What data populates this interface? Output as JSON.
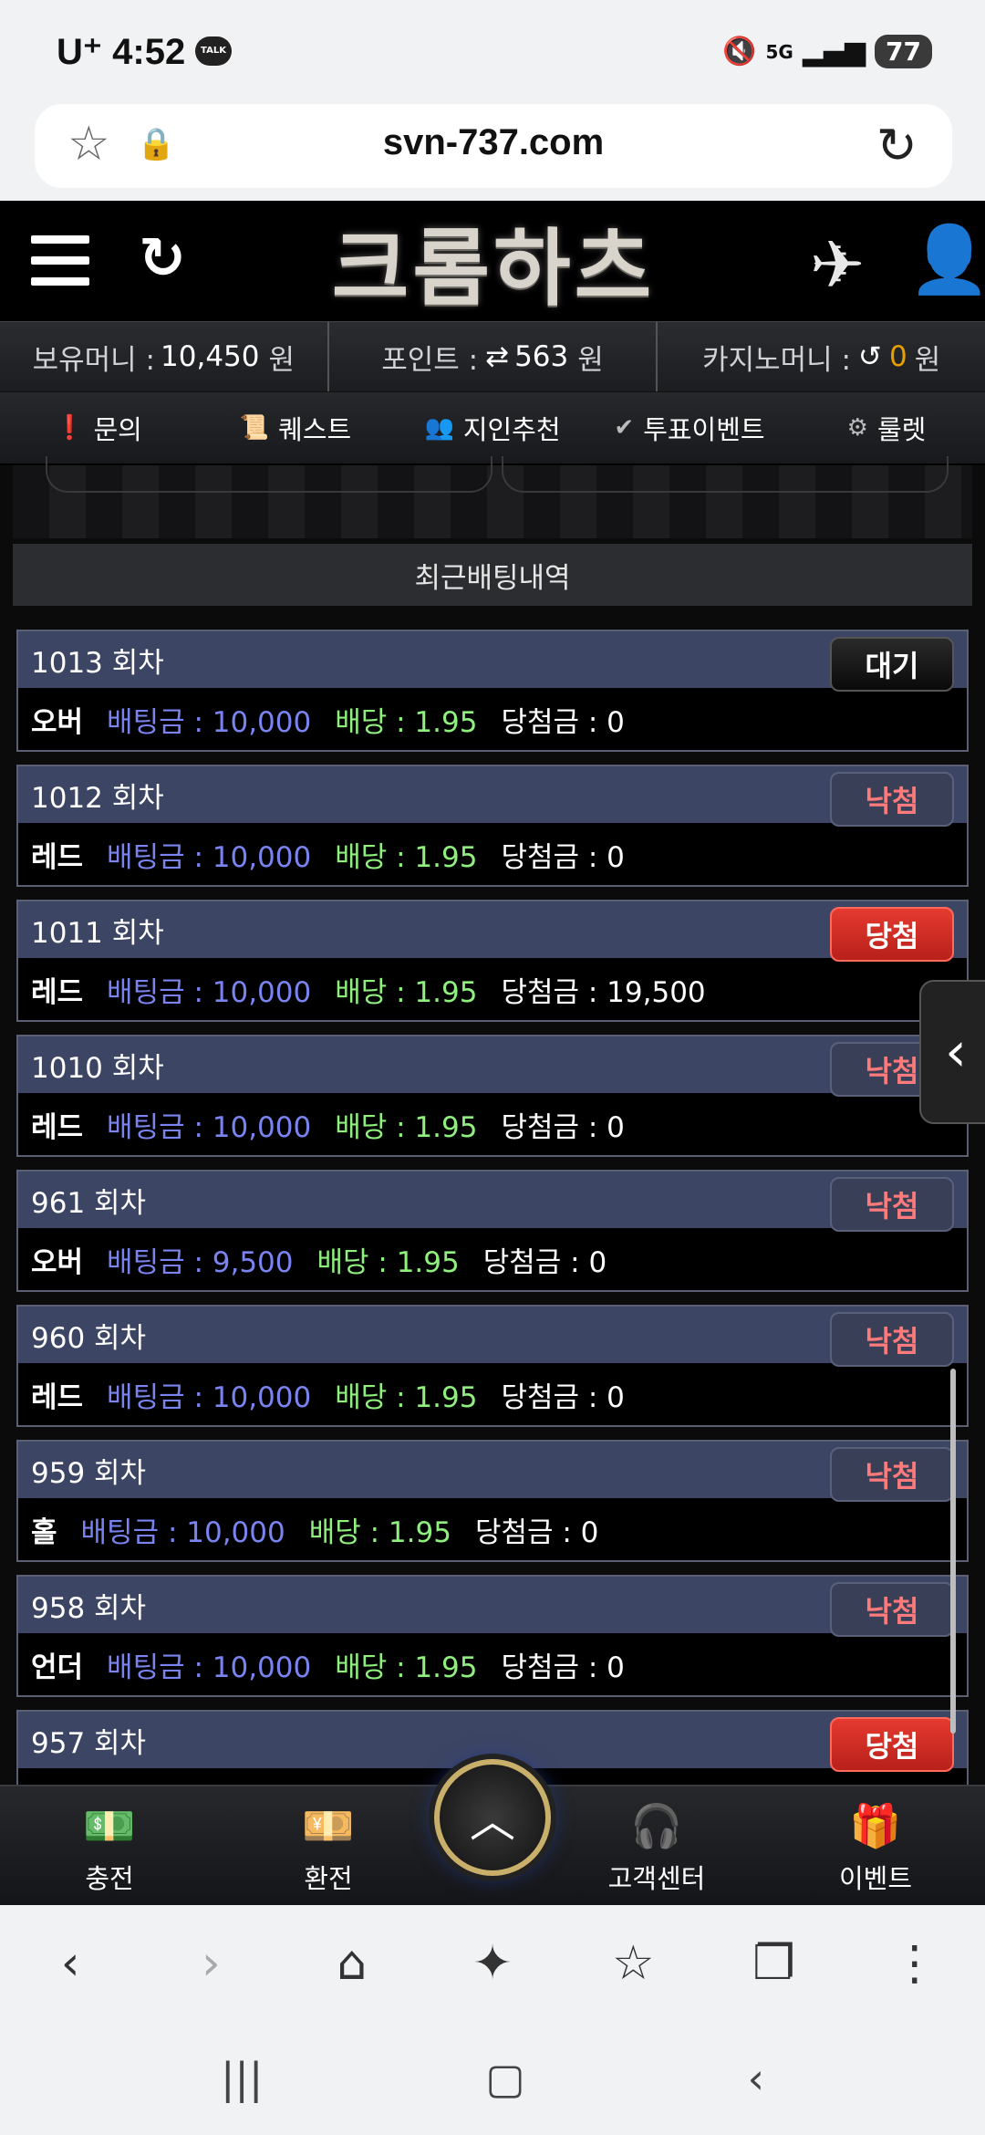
{
  "status_bar": {
    "carrier": "U⁺",
    "time": "4:52",
    "talk_badge": "TALK",
    "network": "5G",
    "battery": "77"
  },
  "browser": {
    "url": "svn-737.com"
  },
  "header": {
    "logo_text": "크롬하츠"
  },
  "money_bar": {
    "holding_label": "보유머니 :",
    "holding_value": "10,450",
    "holding_unit": "원",
    "point_label": "포인트 :",
    "point_value": "563",
    "point_unit": "원",
    "casino_label": "카지노머니 :",
    "casino_value": "0",
    "casino_unit": "원"
  },
  "nav_menu": [
    {
      "label": "문의",
      "icon": "info-icon",
      "glyph": "❗"
    },
    {
      "label": "퀘스트",
      "icon": "quest-icon",
      "glyph": "📜"
    },
    {
      "label": "지인추천",
      "icon": "people-icon",
      "glyph": "👥"
    },
    {
      "label": "투표이벤트",
      "icon": "vote-icon",
      "glyph": "✔"
    },
    {
      "label": "룰렛",
      "icon": "roulette-icon",
      "glyph": "⚙"
    }
  ],
  "section_title": "최근배팅내역",
  "bets": [
    {
      "round": "1013 회차",
      "pick": "오버",
      "amount": "배팅금 : 10,000",
      "odds": "배당 : 1.95",
      "winnings": "당첨금 : 0",
      "status": "대기",
      "status_type": "wait"
    },
    {
      "round": "1012 회차",
      "pick": "레드",
      "amount": "배팅금 : 10,000",
      "odds": "배당 : 1.95",
      "winnings": "당첨금 : 0",
      "status": "낙첨",
      "status_type": "lose"
    },
    {
      "round": "1011 회차",
      "pick": "레드",
      "amount": "배팅금 : 10,000",
      "odds": "배당 : 1.95",
      "winnings": "당첨금 : 19,500",
      "status": "당첨",
      "status_type": "win"
    },
    {
      "round": "1010 회차",
      "pick": "레드",
      "amount": "배팅금 : 10,000",
      "odds": "배당 : 1.95",
      "winnings": "당첨금 : 0",
      "status": "낙첨",
      "status_type": "lose"
    },
    {
      "round": "961 회차",
      "pick": "오버",
      "amount": "배팅금 : 9,500",
      "odds": "배당 : 1.95",
      "winnings": "당첨금 : 0",
      "status": "낙첨",
      "status_type": "lose"
    },
    {
      "round": "960 회차",
      "pick": "레드",
      "amount": "배팅금 : 10,000",
      "odds": "배당 : 1.95",
      "winnings": "당첨금 : 0",
      "status": "낙첨",
      "status_type": "lose"
    },
    {
      "round": "959 회차",
      "pick": "홀",
      "amount": "배팅금 : 10,000",
      "odds": "배당 : 1.95",
      "winnings": "당첨금 : 0",
      "status": "낙첨",
      "status_type": "lose"
    },
    {
      "round": "958 회차",
      "pick": "언더",
      "amount": "배팅금 : 10,000",
      "odds": "배당 : 1.95",
      "winnings": "당첨금 : 0",
      "status": "낙첨",
      "status_type": "lose"
    },
    {
      "round": "957 회차",
      "pick": "",
      "amount": "",
      "odds": "",
      "winnings": "",
      "status": "당첨",
      "status_type": "win"
    }
  ],
  "bottom_nav": {
    "deposit": "충전",
    "withdraw": "환전",
    "support": "고객센터",
    "event": "이벤트"
  },
  "colors": {
    "card_header": "#3d4564",
    "amount_text": "#7a84f0",
    "odds_text": "#8ff07e",
    "win_badge": "#e53a30",
    "lose_text": "#ff7a7a",
    "casino_zero": "#e8a000"
  }
}
